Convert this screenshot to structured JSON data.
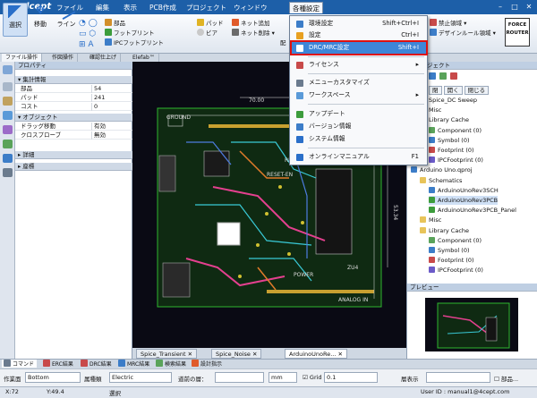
{
  "app": {
    "logo": "Quadcept"
  },
  "menubar": [
    "ファイル",
    "編集",
    "表示",
    "PCB作成",
    "プロジェクト",
    "ウィンドウ",
    "各種設定"
  ],
  "toolbar": {
    "select": "選択",
    "move": "移動",
    "line": "ライン",
    "parts": "部品",
    "footprint": "フットプリント",
    "ipc_footprint": "IPCフットプリント",
    "pad": "パッド",
    "via": "ビア",
    "net_add": "ネット追加",
    "net_delete": "ネット削除",
    "partial": "配",
    "forbid": "禁止領域",
    "design_rule": "デザインルール領域",
    "force_line1": "FORCE",
    "force_line2": "ROUTER"
  },
  "subtabs": [
    "ファイル操作",
    "作図操作",
    "確認仕上げ",
    "Elefab™"
  ],
  "properties": {
    "title": "プロパティ",
    "summary_header": "集計情報",
    "rows": [
      {
        "k": "部品",
        "v": "54"
      },
      {
        "k": "パッド",
        "v": "241"
      },
      {
        "k": "コスト",
        "v": "0"
      }
    ],
    "object_header": "オブジェクト",
    "object_rows": [
      {
        "k": "ドラッグ移動",
        "v": "有効"
      },
      {
        "k": "クロスプローブ",
        "v": "無効"
      }
    ],
    "detail_header": "詳細",
    "coord_header": "座標"
  },
  "dropdown": {
    "items": [
      {
        "label": "環境設定",
        "shortcut": "Shift+Ctrl+I"
      },
      {
        "label": "設定",
        "shortcut": "Ctrl+I"
      },
      {
        "label": "DRC/MRC設定",
        "shortcut": "Shift+I"
      },
      {
        "label": "ライセンス",
        "shortcut": "▸"
      },
      {
        "label": "メニューカスタマイズ",
        "shortcut": ""
      },
      {
        "label": "ワークスペース",
        "shortcut": "▸"
      },
      {
        "label": "アップデート",
        "shortcut": ""
      },
      {
        "label": "バージョン情報",
        "shortcut": ""
      },
      {
        "label": "システム情報",
        "shortcut": ""
      },
      {
        "label": "オンラインマニュアル",
        "shortcut": "F1"
      }
    ]
  },
  "project": {
    "header": "ジェクト",
    "buttons": [
      "閉",
      "開く",
      "閉じる"
    ],
    "tree": [
      {
        "label": "Spice_DC Sweep",
        "level": 1,
        "color": "#8a8a8a"
      },
      {
        "label": "Misc",
        "level": 1,
        "color": "#e8c45a"
      },
      {
        "label": "Library Cache",
        "level": 1,
        "color": "#e8c45a"
      },
      {
        "label": "Component (0)",
        "level": 2,
        "color": "#5aa35a"
      },
      {
        "label": "Symbol (0)",
        "level": 2,
        "color": "#3c7dc8"
      },
      {
        "label": "Footprint (0)",
        "level": 2,
        "color": "#c84a4a"
      },
      {
        "label": "IPCFootprint (0)",
        "level": 2,
        "color": "#6b5ac8"
      },
      {
        "label": "Arduino Uno.qproj",
        "level": 0,
        "color": "#3c7dc8"
      },
      {
        "label": "Schematics",
        "level": 1,
        "color": "#e8c45a"
      },
      {
        "label": "ArduinoUnoRev3SCH",
        "level": 2,
        "color": "#3c7dc8"
      },
      {
        "label": "ArduinoUnoRev3PCB",
        "level": 2,
        "color": "#3c9c3c"
      },
      {
        "label": "ArduinoUnoRev3PCB_Panel",
        "level": 2,
        "color": "#3c9c3c"
      },
      {
        "label": "Misc",
        "level": 1,
        "color": "#e8c45a"
      },
      {
        "label": "Library Cache",
        "level": 1,
        "color": "#e8c45a"
      },
      {
        "label": "Component (0)",
        "level": 2,
        "color": "#5aa35a"
      },
      {
        "label": "Symbol (0)",
        "level": 2,
        "color": "#3c7dc8"
      },
      {
        "label": "Footprint (0)",
        "level": 2,
        "color": "#c84a4a"
      },
      {
        "label": "IPCFootprint (0)",
        "level": 2,
        "color": "#6b5ac8"
      }
    ],
    "preview_title": "プレビュー"
  },
  "canvas": {
    "labels": {
      "ground": "GROUND",
      "dim_top": "70.00",
      "dim_right": "53.34",
      "reset": "RESET-EN",
      "rn4": "RN4",
      "power": "POWER",
      "zu4": "ZU4",
      "analog": "ANALOG IN"
    }
  },
  "doctabs": [
    "Spice_Transient",
    "Spice_Noise",
    "ArduinoUnoRe..."
  ],
  "bottomtabs": [
    "コマンド",
    "ERC結果",
    "DRC結果",
    "MRC結果",
    "検索結果",
    "設計指示"
  ],
  "optbar": {
    "layer_label": "作業面",
    "layer_value": "Bottom",
    "type_label": "属種類",
    "type_value": "Electric",
    "prev_label": "道前の層：",
    "unit_value": "mm",
    "grid_label": "Grid",
    "grid_value": "0.1",
    "side_label": "層表示",
    "part_label": "部品..."
  },
  "status": {
    "x": "X:72",
    "y": "Y:49.4",
    "mode": "選択",
    "user": "User ID : manual1@4cept.com"
  }
}
